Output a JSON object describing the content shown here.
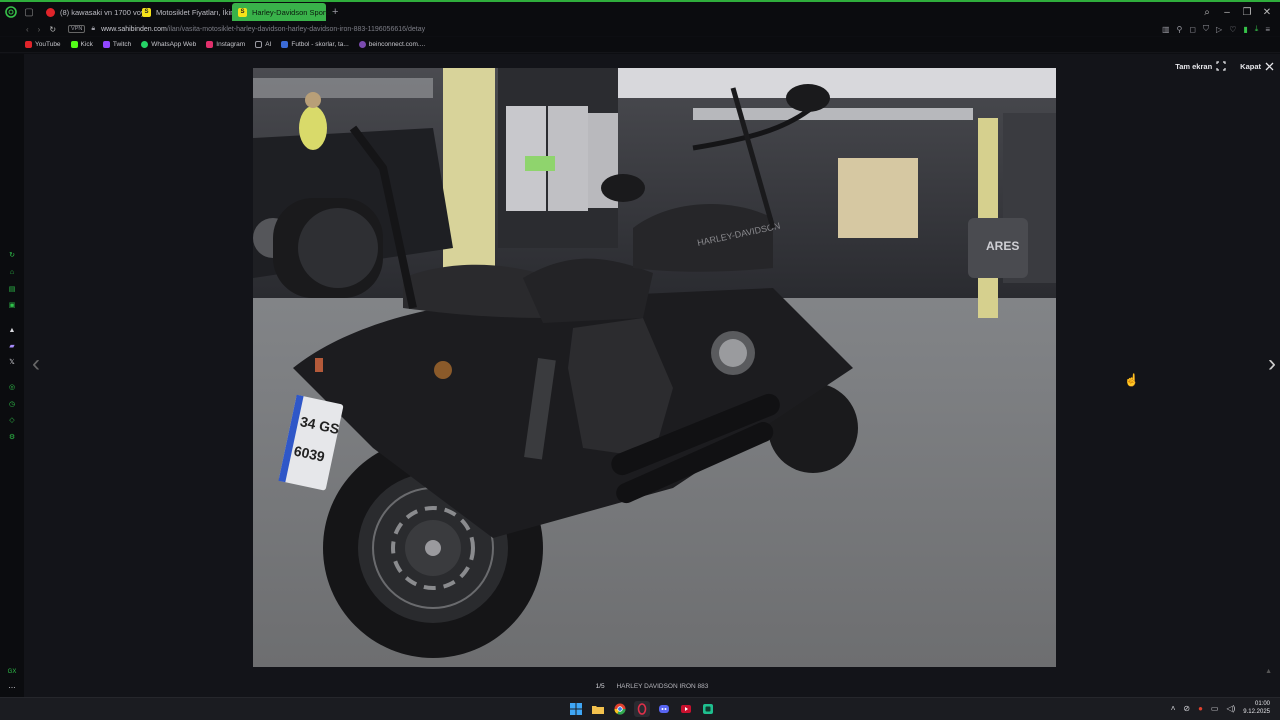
{
  "browser": {
    "tabs": [
      {
        "title": "(8) kawasaki vn 1700 voy",
        "favicon": "youtube-icon"
      },
      {
        "title": "Motosiklet Fiyatları, İkinc",
        "favicon": "sahibinden-icon"
      },
      {
        "title": "Harley-Davidson Sportst",
        "favicon": "sahibinden-icon",
        "active": true
      }
    ],
    "new_tab": "+",
    "vpn": "VPN",
    "url_host": "www.sahibinden.com",
    "url_path": "/ilan/vasita-motosiklet-harley-davidson-harley-davidson-iron-883-1196056616/detay",
    "bookmarks": [
      {
        "label": "YouTube",
        "icon": "youtube-icon",
        "color": "#e0242a"
      },
      {
        "label": "Kick",
        "icon": "kick-icon",
        "color": "#53fc18"
      },
      {
        "label": "Twitch",
        "icon": "twitch-icon",
        "color": "#9146ff"
      },
      {
        "label": "WhatsApp Web",
        "icon": "whatsapp-icon",
        "color": "#25d366"
      },
      {
        "label": "Instagram",
        "icon": "instagram-icon",
        "color": "#e1306c"
      },
      {
        "label": "AI",
        "icon": "folder-icon",
        "color": "#9a9aa2"
      },
      {
        "label": "Futbol - skorlar, ta...",
        "icon": "futbol-icon",
        "color": "#3b6bd6"
      },
      {
        "label": "beinconnect.com....",
        "icon": "bein-icon",
        "color": "#7b4bb0"
      }
    ]
  },
  "viewer": {
    "fullscreen_label": "Tam ekran",
    "close_label": "Kapat",
    "counter": "1/5",
    "caption": "HARLEY DAVIDSON IRON 883",
    "photo_plate_top": "34 GS",
    "photo_plate_bottom": "6039",
    "photo_tank_text": "HARLEY-DAVIDSON",
    "photo_sign_text": "ARES"
  },
  "taskbar": {
    "time": "01:00",
    "date": "9.12.2025"
  },
  "colors": {
    "accent": "#39b24a",
    "background": "#131419"
  }
}
